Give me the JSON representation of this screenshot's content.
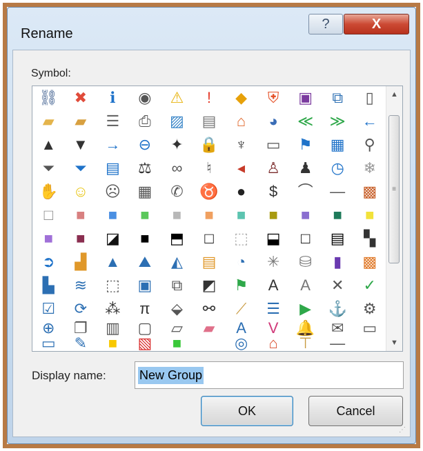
{
  "dialog": {
    "title": "Rename",
    "help_glyph": "?",
    "close_glyph": "X",
    "symbol_label": "Symbol:",
    "display_name_label": "Display name:",
    "display_name_value": "New Group",
    "ok_label": "OK",
    "cancel_label": "Cancel"
  },
  "colors": {
    "frame": "#b87a45",
    "selection": "#99c8f0",
    "close_button": "#cc4a34"
  },
  "scrollbar": {
    "up_glyph": "▲",
    "down_glyph": "▼",
    "thumb_glyph": "≡"
  },
  "symbols": [
    {
      "icon": "org-chart-icon",
      "g": "⛓",
      "c": "#3a5b8c"
    },
    {
      "icon": "error-icon",
      "g": "✖",
      "c": "#e04b3a"
    },
    {
      "icon": "info-icon",
      "g": "ℹ",
      "c": "#1e72c9"
    },
    {
      "icon": "target-icon",
      "g": "◉",
      "c": "#555"
    },
    {
      "icon": "warning-icon",
      "g": "⚠",
      "c": "#e7b20a"
    },
    {
      "icon": "exclamation-icon",
      "g": "!",
      "c": "#e53a2a"
    },
    {
      "icon": "warning-diamond-icon",
      "g": "◆",
      "c": "#e7a10a"
    },
    {
      "icon": "shield-icon",
      "g": "⛨",
      "c": "#e5532a"
    },
    {
      "icon": "save-icon",
      "g": "▣",
      "c": "#7a3a9e"
    },
    {
      "icon": "sync-pages-icon",
      "g": "⧉",
      "c": "#2c6fb3"
    },
    {
      "icon": "document-icon",
      "g": "▯",
      "c": "#555"
    },
    {
      "icon": "folder-open-icon",
      "g": "▰",
      "c": "#e4b44c"
    },
    {
      "icon": "folders-icon",
      "g": "▰",
      "c": "#d8a040"
    },
    {
      "icon": "fax-icon",
      "g": "☰",
      "c": "#666"
    },
    {
      "icon": "printer-icon",
      "g": "⎙",
      "c": "#555"
    },
    {
      "icon": "picture-icon",
      "g": "▨",
      "c": "#3a86c8"
    },
    {
      "icon": "certificate-icon",
      "g": "▤",
      "c": "#777"
    },
    {
      "icon": "home-icon",
      "g": "⌂",
      "c": "#e0662a"
    },
    {
      "icon": "pie-chart-icon",
      "g": "◕",
      "c": "#3a6db6"
    },
    {
      "icon": "rewind-icon",
      "g": "≪",
      "c": "#2fa84a"
    },
    {
      "icon": "fast-forward-icon",
      "g": "≫",
      "c": "#2fa84a"
    },
    {
      "icon": "arrow-left-icon",
      "g": "←",
      "c": "#1e72c9"
    },
    {
      "icon": "triangle-up-icon",
      "g": "▲",
      "c": "#333"
    },
    {
      "icon": "triangle-down-icon",
      "g": "▼",
      "c": "#333"
    },
    {
      "icon": "arrow-right-icon",
      "g": "→",
      "c": "#1e72c9"
    },
    {
      "icon": "circle-arrow-left-icon",
      "g": "⊖",
      "c": "#1e72c9"
    },
    {
      "icon": "pin-icon",
      "g": "✦",
      "c": "#333"
    },
    {
      "icon": "lock-icon",
      "g": "🔒",
      "c": "#d8a040"
    },
    {
      "icon": "key-icon",
      "g": "♆",
      "c": "#333"
    },
    {
      "icon": "scroll-icon",
      "g": "▭",
      "c": "#555"
    },
    {
      "icon": "flag-icon",
      "g": "⚑",
      "c": "#1e72c9"
    },
    {
      "icon": "calendar-icon",
      "g": "▦",
      "c": "#1e72c9"
    },
    {
      "icon": "search-icon",
      "g": "⚲",
      "c": "#555"
    },
    {
      "icon": "filter-icon",
      "g": "⏷",
      "c": "#555"
    },
    {
      "icon": "filter-blue-icon",
      "g": "⏷",
      "c": "#1e72c9"
    },
    {
      "icon": "book-icon",
      "g": "▤",
      "c": "#1e72c9"
    },
    {
      "icon": "scales-icon",
      "g": "⚖",
      "c": "#333"
    },
    {
      "icon": "rings-icon",
      "g": "∞",
      "c": "#555"
    },
    {
      "icon": "microphone-icon",
      "g": "♮",
      "c": "#555"
    },
    {
      "icon": "mute-icon",
      "g": "◂",
      "c": "#c73b2a"
    },
    {
      "icon": "user-tie-icon",
      "g": "♙",
      "c": "#7a2a2a"
    },
    {
      "icon": "user-icon",
      "g": "♟",
      "c": "#333"
    },
    {
      "icon": "clock-icon",
      "g": "◷",
      "c": "#1e72c9"
    },
    {
      "icon": "snowflake-icon",
      "g": "❄",
      "c": "#999"
    },
    {
      "icon": "hand-icon",
      "g": "✋",
      "c": "#555"
    },
    {
      "icon": "smiley-icon",
      "g": "☺",
      "c": "#e8c410"
    },
    {
      "icon": "frown-icon",
      "g": "☹",
      "c": "#555"
    },
    {
      "icon": "calculator-icon",
      "g": "▦",
      "c": "#555"
    },
    {
      "icon": "phone-icon",
      "g": "✆",
      "c": "#555"
    },
    {
      "icon": "piggy-bank-icon",
      "g": "♉",
      "c": "#666"
    },
    {
      "icon": "eight-ball-icon",
      "g": "●",
      "c": "#222"
    },
    {
      "icon": "dollar-icon",
      "g": "$",
      "c": "#333"
    },
    {
      "icon": "eye-icon",
      "g": "⌒",
      "c": "#555"
    },
    {
      "icon": "horizontal-line-icon",
      "g": "—",
      "c": "#555"
    },
    {
      "icon": "mosaic-icon",
      "g": "▩",
      "c": "#c8602a"
    },
    {
      "icon": "white-square-icon",
      "g": "□",
      "c": "#888"
    },
    {
      "icon": "rose-square-icon",
      "g": "■",
      "c": "#d88080"
    },
    {
      "icon": "blue-square-icon",
      "g": "■",
      "c": "#4a8fe2"
    },
    {
      "icon": "green-square-icon",
      "g": "■",
      "c": "#5ac85a"
    },
    {
      "icon": "gray-square-icon",
      "g": "■",
      "c": "#b8b8b8"
    },
    {
      "icon": "orange-square-icon",
      "g": "■",
      "c": "#f0a060"
    },
    {
      "icon": "teal-square-icon",
      "g": "■",
      "c": "#5cc4b0"
    },
    {
      "icon": "olive-square-icon",
      "g": "■",
      "c": "#a89a10"
    },
    {
      "icon": "purple-square-icon",
      "g": "■",
      "c": "#8a6ed0"
    },
    {
      "icon": "dark-green-square-icon",
      "g": "■",
      "c": "#1e7a5a"
    },
    {
      "icon": "yellow-square-icon",
      "g": "■",
      "c": "#f2e23a"
    },
    {
      "icon": "violet-square-icon",
      "g": "■",
      "c": "#a070d8"
    },
    {
      "icon": "maroon-square-icon",
      "g": "■",
      "c": "#8a2e50"
    },
    {
      "icon": "half-black-square-icon",
      "g": "◪",
      "c": "#111"
    },
    {
      "icon": "black-square-icon",
      "g": "■",
      "c": "#000"
    },
    {
      "icon": "top-black-square-icon",
      "g": "⬒",
      "c": "#000"
    },
    {
      "icon": "bold-square-icon",
      "g": "□",
      "c": "#000"
    },
    {
      "icon": "dotted-square-icon",
      "g": "⬚",
      "c": "#aaa"
    },
    {
      "icon": "bottom-black-square-icon",
      "g": "⬓",
      "c": "#000"
    },
    {
      "icon": "outline-square-icon",
      "g": "□",
      "c": "#000"
    },
    {
      "icon": "banded-square-icon",
      "g": "▤",
      "c": "#000"
    },
    {
      "icon": "checkerboard-icon",
      "g": "▚",
      "c": "#333"
    },
    {
      "icon": "circle-arrow-right-icon",
      "g": "➲",
      "c": "#1e72c9"
    },
    {
      "icon": "bar-chart-icon",
      "g": "▟",
      "c": "#e0982a"
    },
    {
      "icon": "cone-icon",
      "g": "▲",
      "c": "#2c6fb3"
    },
    {
      "icon": "mountain-icon",
      "g": "⛰",
      "c": "#2c6fb3"
    },
    {
      "icon": "area-chart-icon",
      "g": "◭",
      "c": "#2c6fb3"
    },
    {
      "icon": "horizontal-bar-icon",
      "g": "▤",
      "c": "#e0982a"
    },
    {
      "icon": "pie-slice-icon",
      "g": "◔",
      "c": "#2c6fb3"
    },
    {
      "icon": "radar-chart-icon",
      "g": "✳",
      "c": "#777"
    },
    {
      "icon": "database-icon",
      "g": "⛁",
      "c": "#777"
    },
    {
      "icon": "purple-book-icon",
      "g": "▮",
      "c": "#6a3ab0"
    },
    {
      "icon": "orange-box-icon",
      "g": "▩",
      "c": "#e07a2a"
    },
    {
      "icon": "chart-edit-icon",
      "g": "▙",
      "c": "#2c6fb3"
    },
    {
      "icon": "line-chart-icon",
      "g": "≋",
      "c": "#2c6fb3"
    },
    {
      "icon": "dashed-frame-icon",
      "g": "⬚",
      "c": "#555"
    },
    {
      "icon": "person-frame-icon",
      "g": "▣",
      "c": "#2c6fb3"
    },
    {
      "icon": "nested-frame-icon",
      "g": "⧉",
      "c": "#555"
    },
    {
      "icon": "half-slash-icon",
      "g": "◩",
      "c": "#333"
    },
    {
      "icon": "flags-icon",
      "g": "⚑",
      "c": "#2fa84a"
    },
    {
      "icon": "text-box-a-icon",
      "g": "A",
      "c": "#333"
    },
    {
      "icon": "gray-text-a-icon",
      "g": "A",
      "c": "#777"
    },
    {
      "icon": "x-mark-icon",
      "g": "✕",
      "c": "#555"
    },
    {
      "icon": "check-mark-icon",
      "g": "✓",
      "c": "#2fa84a"
    },
    {
      "icon": "checklist-icon",
      "g": "☑",
      "c": "#2c6fb3"
    },
    {
      "icon": "refresh-icon",
      "g": "⟳",
      "c": "#2c6fb3"
    },
    {
      "icon": "binary-icon",
      "g": "⁂",
      "c": "#333"
    },
    {
      "icon": "pi-icon",
      "g": "π",
      "c": "#333"
    },
    {
      "icon": "paint-bucket-icon",
      "g": "⬙",
      "c": "#555"
    },
    {
      "icon": "binoculars-icon",
      "g": "⚯",
      "c": "#333"
    },
    {
      "icon": "broom-icon",
      "g": "⟋",
      "c": "#c89a40"
    },
    {
      "icon": "bullet-list-icon",
      "g": "☰",
      "c": "#2c6fb3"
    },
    {
      "icon": "play-icon",
      "g": "▶",
      "c": "#2fa84a"
    },
    {
      "icon": "anchor-icon",
      "g": "⚓",
      "c": "#2c6fb3"
    },
    {
      "icon": "briefcase-gear-icon",
      "g": "⚙",
      "c": "#555"
    },
    {
      "icon": "magnifier-plus-icon",
      "g": "⊕",
      "c": "#2c6fb3"
    },
    {
      "icon": "copy-icon",
      "g": "❐",
      "c": "#555"
    },
    {
      "icon": "clipboard-icon",
      "g": "▥",
      "c": "#555"
    },
    {
      "icon": "document-frame-icon",
      "g": "▢",
      "c": "#555"
    },
    {
      "icon": "folded-page-icon",
      "g": "▱",
      "c": "#555"
    },
    {
      "icon": "eraser-icon",
      "g": "▰",
      "c": "#e0708a"
    },
    {
      "icon": "italic-a-icon",
      "g": "A",
      "c": "#2c6fb3"
    },
    {
      "icon": "color-v-icon",
      "g": "V",
      "c": "#d03a7a"
    },
    {
      "icon": "bell-icon",
      "g": "🔔",
      "c": "#e0b020"
    },
    {
      "icon": "envelope-open-icon",
      "g": "✉",
      "c": "#555"
    },
    {
      "icon": "envelope-icon",
      "g": "▭",
      "c": "#555"
    },
    {
      "icon": "envelope-blue-icon",
      "g": "▭",
      "c": "#2c6fb3"
    },
    {
      "icon": "edit-form-icon",
      "g": "✎",
      "c": "#2c6fb3"
    },
    {
      "icon": "yellow-block-icon",
      "g": "■",
      "c": "#f8c800"
    },
    {
      "icon": "red-hatch-icon",
      "g": "▧",
      "c": "#d82a2a"
    },
    {
      "icon": "green-block-icon",
      "g": "■",
      "c": "#3ac83a"
    },
    {
      "icon": "blank-cell-icon",
      "g": " ",
      "c": "#fff"
    },
    {
      "icon": "globe-e-icon",
      "g": "◎",
      "c": "#2c6fb3"
    },
    {
      "icon": "home-globe-icon",
      "g": "⌂",
      "c": "#d84a2a"
    },
    {
      "icon": "signpost-icon",
      "g": "⊤",
      "c": "#c89a40"
    },
    {
      "icon": "dash-line-icon",
      "g": "—",
      "c": "#555"
    },
    {
      "icon": "blank-end-icon",
      "g": " ",
      "c": "#fff"
    }
  ]
}
